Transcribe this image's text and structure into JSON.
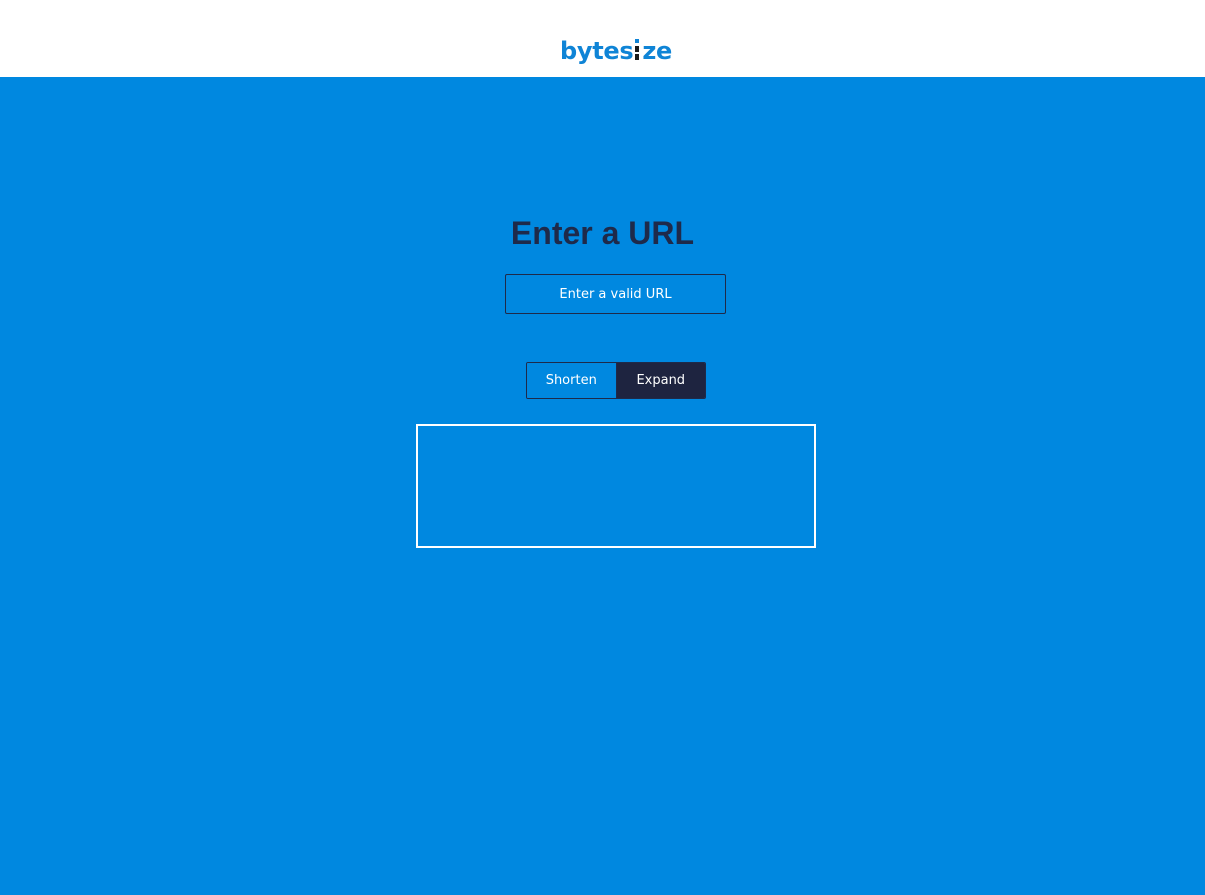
{
  "header": {
    "logo_part1": "bytes",
    "logo_part2": "ze"
  },
  "main": {
    "title": "Enter a URL",
    "url_input": {
      "placeholder": "Enter a valid URL",
      "value": ""
    },
    "toggle": {
      "shorten_label": "Shorten",
      "expand_label": "Expand",
      "selected": "Expand"
    },
    "result": {
      "text": ""
    }
  },
  "colors": {
    "background": "#0088e0",
    "header_background": "#ffffff",
    "logo": "#0f84d6",
    "heading": "#1e2a4a",
    "expand_active": "#1e2440",
    "result_border": "#ffffff"
  }
}
